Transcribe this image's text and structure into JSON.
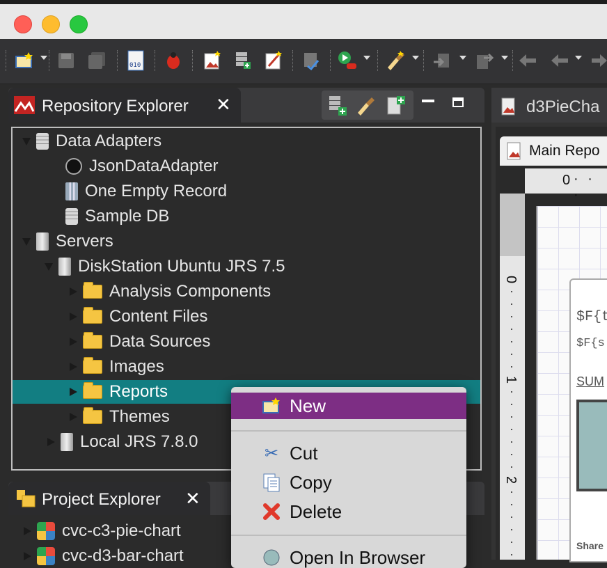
{
  "window": {
    "lights": [
      "#ff5f57",
      "#febc2e",
      "#28c840"
    ]
  },
  "toolbar": {
    "icons": [
      "new-report-icon",
      "save-icon",
      "save-all-icon",
      "compile-icon",
      "debug-icon",
      "new-image-icon",
      "add-data-adapter-icon",
      "edit-icon",
      "check-icon",
      "run-icon",
      "edit-style-icon",
      "import-icon",
      "export-icon",
      "back-icon",
      "back-arrow-icon",
      "forward-icon"
    ]
  },
  "repository": {
    "tab_title": "Repository Explorer",
    "tree": [
      {
        "label": "Data Adapters",
        "depth": 0,
        "icon": "database-icon",
        "expanded": true
      },
      {
        "label": "JsonDataAdapter",
        "depth": 1,
        "icon": "json-adapter-icon"
      },
      {
        "label": "One Empty Record",
        "depth": 1,
        "icon": "empty-record-icon"
      },
      {
        "label": "Sample DB",
        "depth": 1,
        "icon": "database-icon"
      },
      {
        "label": "Servers",
        "depth": 0,
        "icon": "server-icon",
        "expanded": true
      },
      {
        "label": "DiskStation Ubuntu JRS 7.5",
        "depth": 1,
        "icon": "server-icon",
        "expanded": true
      },
      {
        "label": "Analysis Components",
        "depth": 2,
        "icon": "folder-icon"
      },
      {
        "label": "Content Files",
        "depth": 2,
        "icon": "folder-icon"
      },
      {
        "label": "Data Sources",
        "depth": 2,
        "icon": "folder-icon"
      },
      {
        "label": "Images",
        "depth": 2,
        "icon": "folder-icon"
      },
      {
        "label": "Reports",
        "depth": 2,
        "icon": "folder-icon",
        "selected": true
      },
      {
        "label": "Themes",
        "depth": 2,
        "icon": "folder-icon"
      },
      {
        "label": "Local JRS 7.8.0",
        "depth": 1,
        "icon": "server-icon"
      }
    ]
  },
  "project": {
    "tab_title": "Project Explorer",
    "items": [
      "cvc-c3-pie-chart",
      "cvc-d3-bar-chart"
    ]
  },
  "context_menu": {
    "items": [
      {
        "label": "New",
        "icon": "new-icon",
        "highlighted": true
      },
      {
        "label": "Cut",
        "icon": "scissors-icon"
      },
      {
        "label": "Copy",
        "icon": "copy-icon"
      },
      {
        "label": "Delete",
        "icon": "delete-icon"
      },
      {
        "label": "Open In Browser",
        "icon": "browser-icon"
      }
    ]
  },
  "editor": {
    "tab_title": "d3PieCha",
    "subtab_title": "Main Repo",
    "ruler_h_zero": "0",
    "ruler_v_labels": [
      "0",
      "1",
      "2"
    ],
    "fields": [
      "$F{t",
      "$F{s",
      "SUM",
      "Share"
    ]
  }
}
